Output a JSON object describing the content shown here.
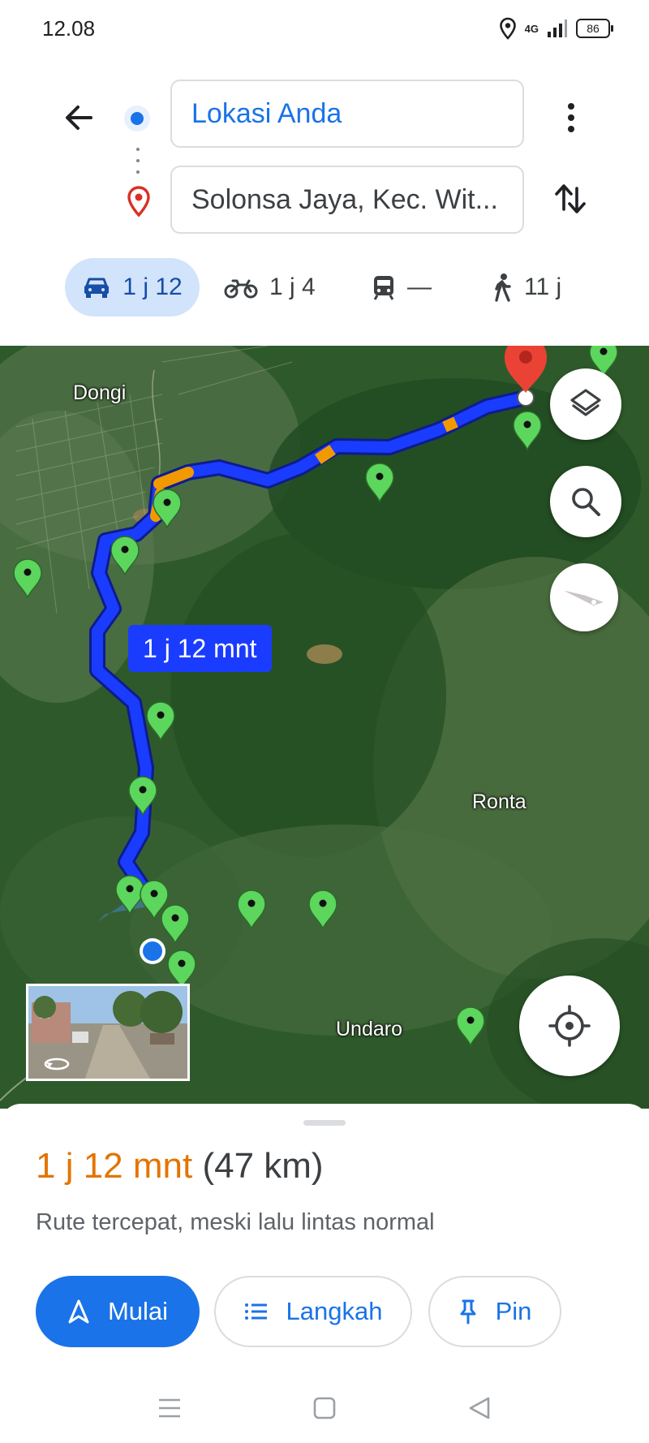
{
  "status_bar": {
    "time": "12.08",
    "network": "4G",
    "battery": "86"
  },
  "search": {
    "origin": "Lokasi Anda",
    "destination": "Solonsa Jaya, Kec. Wit..."
  },
  "modes": [
    {
      "name": "car",
      "label": "1 j 12",
      "selected": true
    },
    {
      "name": "motorcycle",
      "label": "1 j 4"
    },
    {
      "name": "transit",
      "label": "—"
    },
    {
      "name": "walk",
      "label": "11 j"
    }
  ],
  "map": {
    "places": [
      "Dongi",
      "Ronta",
      "Undaro"
    ],
    "route_label": "1 j 12 mnt"
  },
  "summary": {
    "duration": "1 j 12 mnt",
    "distance": "(47 km)",
    "description": "Rute tercepat, meski lalu lintas normal"
  },
  "actions": {
    "start": "Mulai",
    "steps": "Langkah",
    "pin": "Pin"
  },
  "colors": {
    "accent": "#1a73e8",
    "traffic": "#e37400",
    "route": "#1a3cff",
    "pin_green": "#5cd65c",
    "pin_red": "#ea4335"
  }
}
